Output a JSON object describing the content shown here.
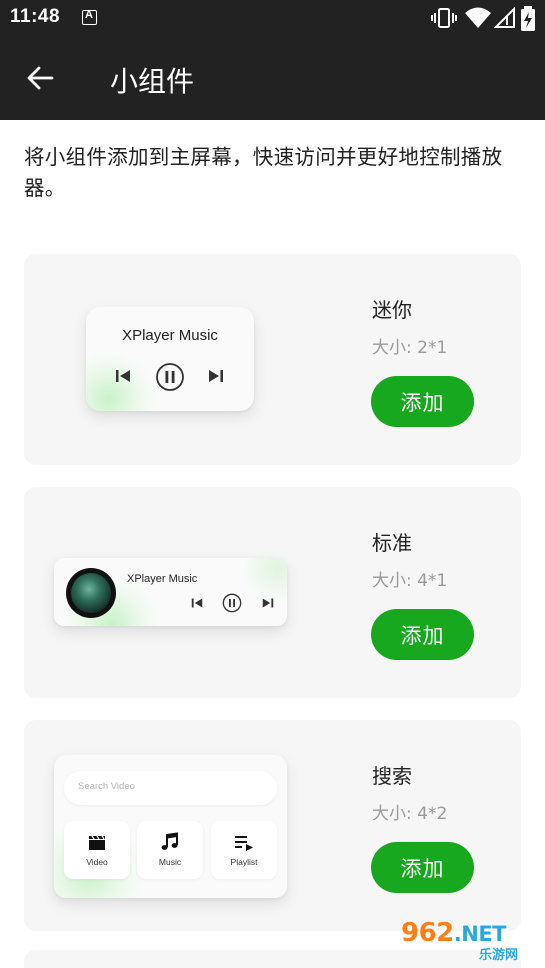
{
  "status_bar": {
    "time": "11:48",
    "icons": [
      "notification-a-icon",
      "vibrate-icon",
      "wifi-icon",
      "signal-icon",
      "battery-charging-icon"
    ]
  },
  "app_bar": {
    "back_icon": "arrow-left-icon",
    "title": "小组件"
  },
  "intro": "将小组件添加到主屏幕，快速访问并更好地控制播放器。",
  "widgets": [
    {
      "name": "迷你",
      "size": "大小: 2*1",
      "add_label": "添加",
      "preview": {
        "title": "XPlayer Music",
        "controls": [
          "previous-icon",
          "pause-icon",
          "next-icon"
        ]
      }
    },
    {
      "name": "标准",
      "size": "大小: 4*1",
      "add_label": "添加",
      "preview": {
        "title": "XPlayer Music",
        "controls": [
          "previous-icon",
          "pause-icon",
          "next-icon"
        ]
      }
    },
    {
      "name": "搜索",
      "size": "大小: 4*2",
      "add_label": "添加",
      "preview": {
        "search_placeholder": "Search Video",
        "tiles": [
          {
            "label": "Video",
            "icon": "clapperboard-icon"
          },
          {
            "label": "Music",
            "icon": "music-note-icon"
          },
          {
            "label": "Playlist",
            "icon": "playlist-icon"
          }
        ]
      }
    }
  ],
  "watermark": {
    "main": "962",
    "suffix": ".NET",
    "sub": "乐游网"
  },
  "colors": {
    "app_bar_bg": "#222222",
    "accent_green": "#18a81f",
    "card_bg": "#f6f6f6"
  }
}
